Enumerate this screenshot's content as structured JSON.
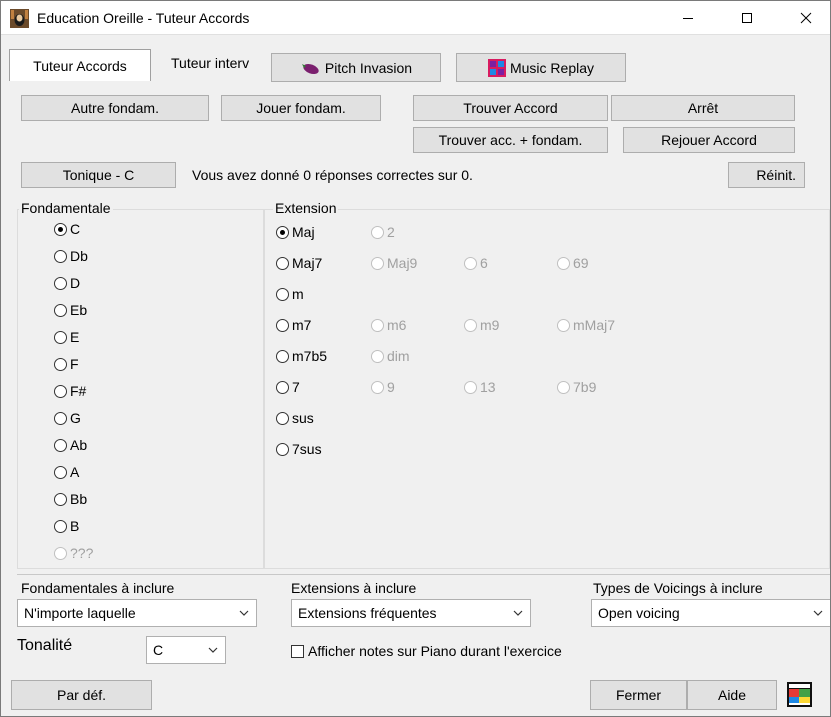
{
  "window": {
    "title": "Education Oreille - Tuteur Accords",
    "minimize_icon": "minimize-icon",
    "maximize_icon": "maximize-icon",
    "close_icon": "close-icon"
  },
  "tabs": [
    {
      "label": "Tuteur Accords"
    },
    {
      "label": "Tuteur interv"
    }
  ],
  "toolbar": {
    "pitch_invasion": "Pitch Invasion",
    "music_replay": "Music Replay"
  },
  "buttons": {
    "autre_fondam": "Autre fondam.",
    "jouer_fondam": "Jouer fondam.",
    "trouver_accord": "Trouver Accord",
    "arret": "Arrêt",
    "trouver_acc_fondam": "Trouver acc. + fondam.",
    "rejouer_accord": "Rejouer Accord",
    "tonique": "Tonique - C",
    "reinit": "Réinit.",
    "par_def": "Par déf.",
    "fermer": "Fermer",
    "aide": "Aide"
  },
  "status_text": "Vous avez donné 0 réponses correctes sur 0.",
  "fondamentale": {
    "label": "Fondamentale",
    "options": [
      "C",
      "Db",
      "D",
      "Eb",
      "E",
      "F",
      "F#",
      "G",
      "Ab",
      "A",
      "Bb",
      "B",
      "???"
    ],
    "selected": "C"
  },
  "extension": {
    "label": "Extension",
    "rows": [
      [
        "Maj",
        "2"
      ],
      [
        "Maj7",
        "Maj9",
        "6",
        "69"
      ],
      [
        "m"
      ],
      [
        "m7",
        "m6",
        "m9",
        "mMaj7"
      ],
      [
        "m7b5",
        "dim"
      ],
      [
        "7",
        "9",
        "13",
        "7b9"
      ],
      [
        "sus"
      ],
      [
        "7sus"
      ]
    ],
    "selected": "Maj"
  },
  "bottom": {
    "fondamentales_label": "Fondamentales à inclure",
    "fondamentales_value": "N'importe laquelle",
    "extensions_label": "Extensions à inclure",
    "extensions_value": "Extensions fréquentes",
    "voicings_label": "Types de Voicings à inclure",
    "voicings_value": "Open voicing",
    "tonalite_label": "Tonalité",
    "tonalite_value": "C",
    "afficher_label": "Afficher notes sur Piano durant l'exercice",
    "afficher_checked": false
  },
  "colors": {
    "window_bg": "#f0f0f0",
    "button_bg": "#e1e1e1",
    "disabled_text": "#a0a0a0"
  }
}
